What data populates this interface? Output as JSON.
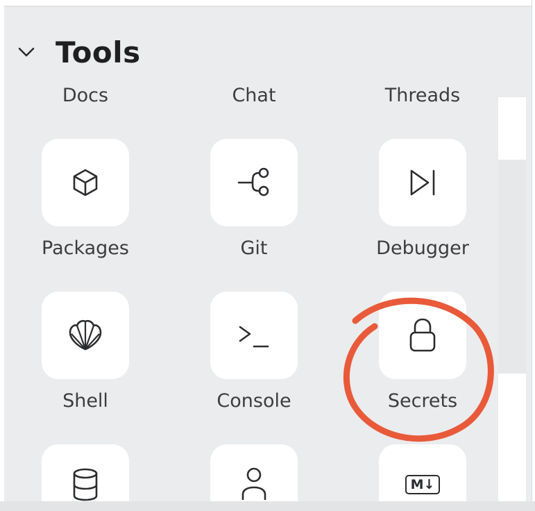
{
  "section": {
    "title": "Tools",
    "chevron_icon": "chevron-down-icon"
  },
  "partial_labels": [
    "Docs",
    "Chat",
    "Threads"
  ],
  "tools": [
    {
      "label": "Packages",
      "icon": "cube-icon"
    },
    {
      "label": "Git",
      "icon": "git-branch-icon"
    },
    {
      "label": "Debugger",
      "icon": "debugger-play-icon"
    },
    {
      "label": "Shell",
      "icon": "shell-icon"
    },
    {
      "label": "Console",
      "icon": "terminal-prompt-icon"
    },
    {
      "label": "Secrets",
      "icon": "lock-icon"
    }
  ],
  "partial_tools": [
    {
      "icon": "database-icon"
    },
    {
      "icon": "user-icon"
    },
    {
      "icon": "markdown-icon",
      "text": "M↓"
    }
  ],
  "colors": {
    "panel_bg": "#ebeced",
    "tile_bg": "#ffffff",
    "text": "#3c3d40",
    "title": "#1f1f22",
    "annotation": "#e85a3a"
  }
}
